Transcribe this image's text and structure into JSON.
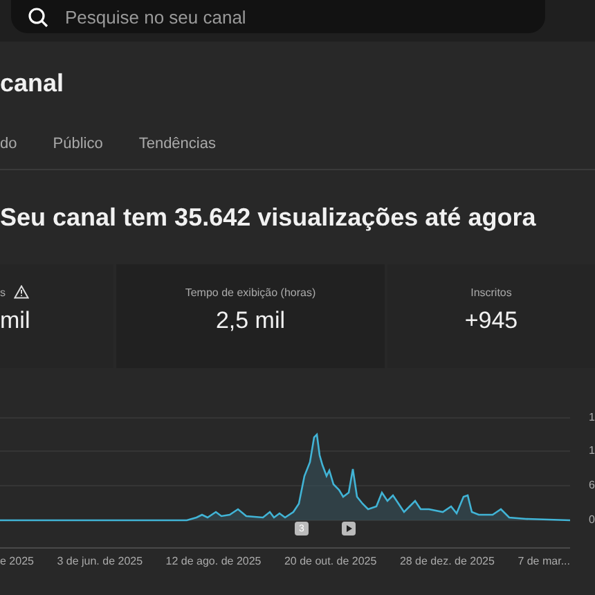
{
  "search": {
    "placeholder": "Pesquise no seu canal"
  },
  "page_title": "canal",
  "tabs": [
    {
      "label": "do",
      "selected": false
    },
    {
      "label": "Público",
      "selected": false
    },
    {
      "label": "Tendências",
      "selected": false
    }
  ],
  "headline": "Seu canal tem 35.642 visualizações até agora",
  "metrics": [
    {
      "label": "s",
      "value": "mil",
      "warning": true
    },
    {
      "label": "Tempo de exibição (horas)",
      "value": "2,5 mil",
      "warning": false
    },
    {
      "label": "Inscritos",
      "value": "+945",
      "warning": false
    }
  ],
  "chart": {
    "y_labels": [
      "1",
      "1",
      "6",
      "0"
    ],
    "x_labels": [
      "e 2025",
      "3 de jun. de 2025",
      "12 de ago. de 2025",
      "20 de out. de 2025",
      "28 de dez. de 2025",
      "7 de mar..."
    ],
    "markers": [
      {
        "kind": "number",
        "text": "3"
      },
      {
        "kind": "play"
      }
    ]
  }
}
